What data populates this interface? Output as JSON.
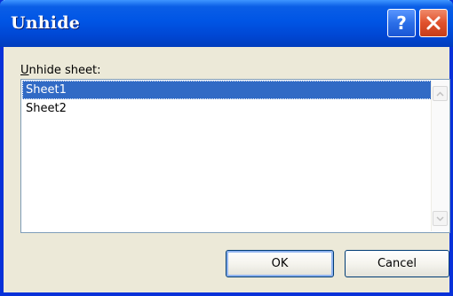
{
  "dialog": {
    "title": "Unhide",
    "help_glyph": "?",
    "help_icon": "help-icon",
    "close_icon": "close-icon",
    "label_accel": "U",
    "label_rest": "nhide sheet:",
    "sheets": [
      {
        "name": "Sheet1",
        "selected": true
      },
      {
        "name": "Sheet2",
        "selected": false
      }
    ],
    "ok_label": "OK",
    "cancel_label": "Cancel"
  },
  "colors": {
    "titlebar": "#0055e5",
    "frame": "#0831d9",
    "dialog_bg": "#ece9d8",
    "selection": "#316ac5",
    "close_button": "#e0512c",
    "help_button": "#2b6fe8"
  }
}
